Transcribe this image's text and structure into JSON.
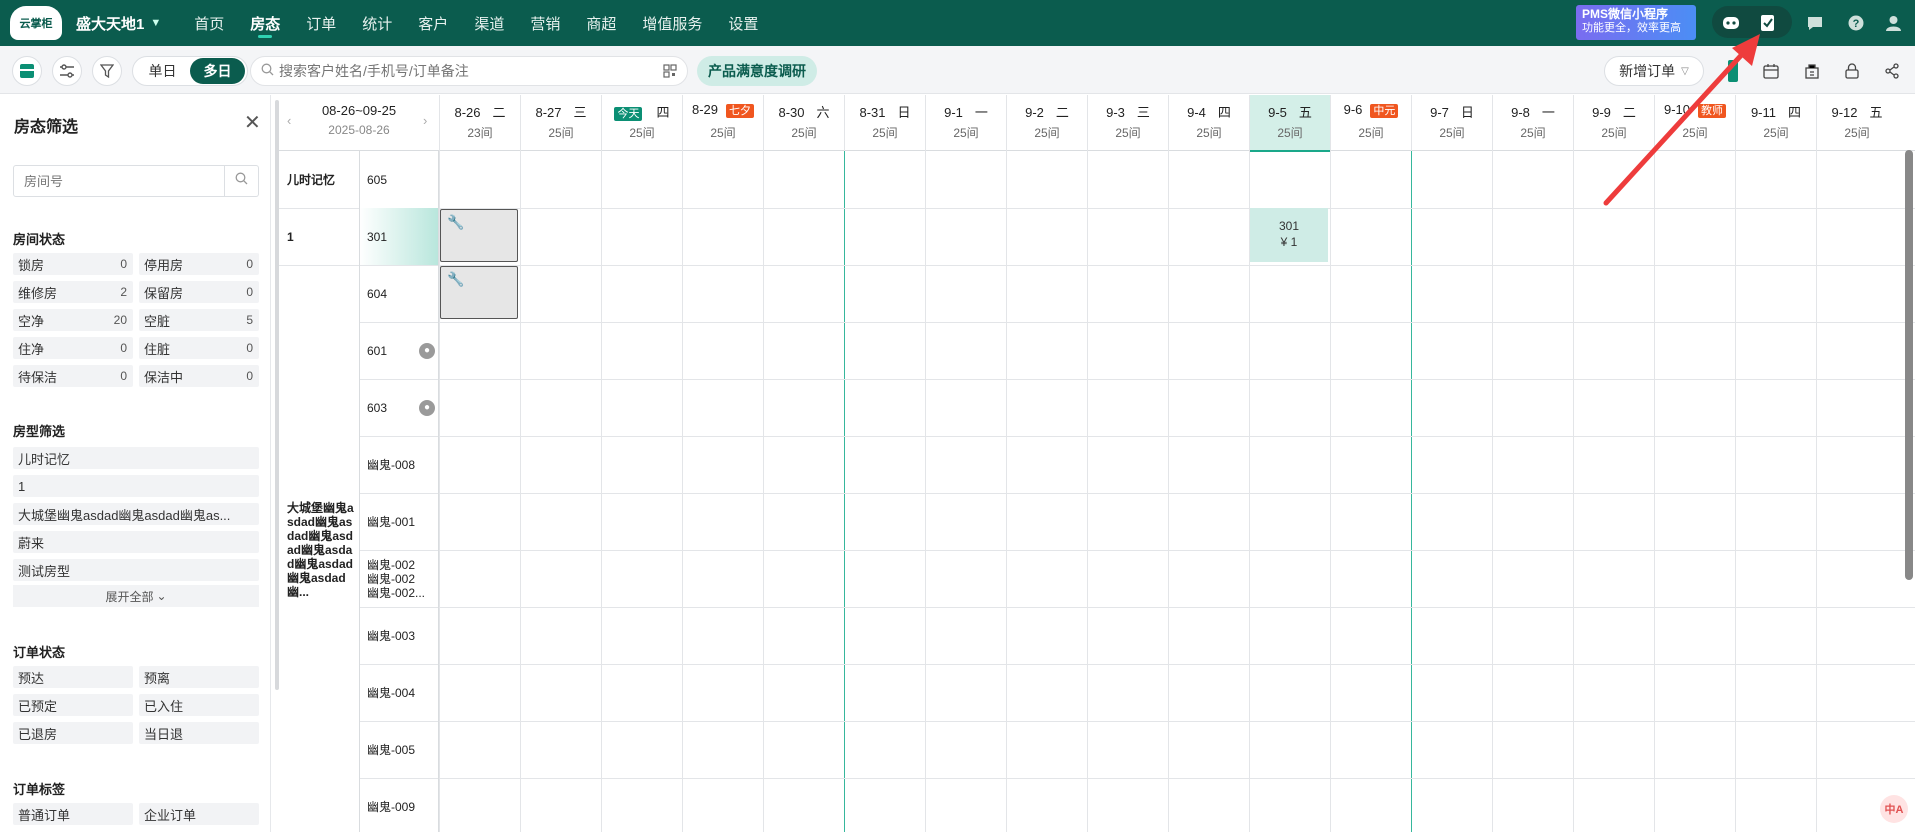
{
  "topbar": {
    "logo_text": "云掌柜",
    "hotel_name": "盛大天地1",
    "nav": [
      "首页",
      "房态",
      "订单",
      "统计",
      "客户",
      "渠道",
      "营销",
      "商超",
      "增值服务",
      "设置"
    ],
    "active_nav": "房态",
    "banner_line1": "PMS微信小程序",
    "banner_line2": "功能更全，效率更高"
  },
  "toolbar": {
    "seg_single": "单日",
    "seg_multi": "多日",
    "search_placeholder": "搜索客户姓名/手机号/订单备注",
    "survey": "产品满意度调研",
    "new_order": "新增订单"
  },
  "sidebar": {
    "title": "房态筛选",
    "room_placeholder": "房间号",
    "room_status_title": "房间状态",
    "room_status": [
      {
        "label": "锁房",
        "count": "0"
      },
      {
        "label": "停用房",
        "count": "0"
      },
      {
        "label": "维修房",
        "count": "2"
      },
      {
        "label": "保留房",
        "count": "0"
      },
      {
        "label": "空净",
        "count": "20"
      },
      {
        "label": "空脏",
        "count": "5"
      },
      {
        "label": "住净",
        "count": "0"
      },
      {
        "label": "住脏",
        "count": "0"
      },
      {
        "label": "待保洁",
        "count": "0"
      },
      {
        "label": "保洁中",
        "count": "0"
      }
    ],
    "room_type_title": "房型筛选",
    "room_types": [
      "儿时记忆",
      "1",
      "大城堡幽鬼asdad幽鬼asdad幽鬼as...",
      "蔚来",
      "测试房型"
    ],
    "expand_all": "展开全部",
    "order_status_title": "订单状态",
    "order_status": [
      "预达",
      "预离",
      "已预定",
      "已入住",
      "已退房",
      "当日退"
    ],
    "order_tag_title": "订单标签",
    "order_tags": [
      "普通订单",
      "企业订单"
    ]
  },
  "grid": {
    "range_line1": "08-26~09-25",
    "range_line2": "2025-08-26",
    "dates": [
      {
        "date": "8-26",
        "wd": "二",
        "rooms": "23间"
      },
      {
        "date": "8-27",
        "wd": "三",
        "rooms": "25间"
      },
      {
        "date": "",
        "wd": "四",
        "rooms": "25间",
        "tag": "今天",
        "tagtype": "today"
      },
      {
        "date": "8-29",
        "wd": "",
        "rooms": "25间",
        "tag": "七夕",
        "tagtype": "fest"
      },
      {
        "date": "8-30",
        "wd": "六",
        "rooms": "25间"
      },
      {
        "date": "8-31",
        "wd": "日",
        "rooms": "25间"
      },
      {
        "date": "9-1",
        "wd": "一",
        "rooms": "25间"
      },
      {
        "date": "9-2",
        "wd": "二",
        "rooms": "25间"
      },
      {
        "date": "9-3",
        "wd": "三",
        "rooms": "25间"
      },
      {
        "date": "9-4",
        "wd": "四",
        "rooms": "25间"
      },
      {
        "date": "9-5",
        "wd": "五",
        "rooms": "25间",
        "selected": true
      },
      {
        "date": "9-6",
        "wd": "",
        "rooms": "25间",
        "tag": "中元",
        "tagtype": "fest"
      },
      {
        "date": "9-7",
        "wd": "日",
        "rooms": "25间"
      },
      {
        "date": "9-8",
        "wd": "一",
        "rooms": "25间"
      },
      {
        "date": "9-9",
        "wd": "二",
        "rooms": "25间"
      },
      {
        "date": "9-10",
        "wd": "",
        "rooms": "25间",
        "tag": "教师",
        "tagtype": "fest"
      },
      {
        "date": "9-11",
        "wd": "四",
        "rooms": "25间"
      },
      {
        "date": "9-12",
        "wd": "五",
        "rooms": "25间"
      }
    ],
    "types": [
      {
        "name": "儿时记忆",
        "rows": 1
      },
      {
        "name": "1",
        "rows": 1
      },
      {
        "name": "大城堡幽鬼asdad幽鬼asdad幽鬼asdad幽鬼asdad幽鬼asdad幽鬼asdad幽...",
        "rows": 10
      }
    ],
    "rooms": [
      {
        "name": "605"
      },
      {
        "name": "301",
        "hl": true
      },
      {
        "name": "604"
      },
      {
        "name": "601",
        "person": true
      },
      {
        "name": "603",
        "person": true
      },
      {
        "name": "幽鬼-008"
      },
      {
        "name": "幽鬼-001"
      },
      {
        "name": "幽鬼-002\n幽鬼-002\n幽鬼-002..."
      },
      {
        "name": "幽鬼-003"
      },
      {
        "name": "幽鬼-004"
      },
      {
        "name": "幽鬼-005"
      },
      {
        "name": "幽鬼-009"
      }
    ],
    "booking_room": "301",
    "booking_price": "¥ 1"
  },
  "translate_label": "中A"
}
